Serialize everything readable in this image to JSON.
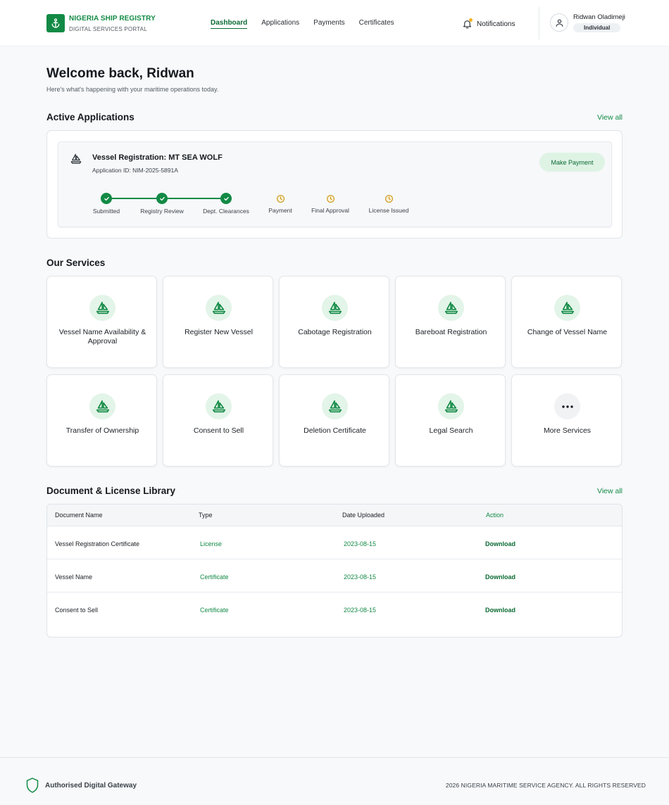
{
  "brand": {
    "title": "NIGERIA SHIP REGISTRY",
    "subtitle": "DIGITAL SERVICES PORTAL",
    "color": "#128a45"
  },
  "nav": [
    {
      "label": "Dashboard",
      "active": true
    },
    {
      "label": "Applications",
      "active": false
    },
    {
      "label": "Payments",
      "active": false
    },
    {
      "label": "Certificates",
      "active": false
    }
  ],
  "header": {
    "notifications_label": "Notifications",
    "user_name": "Ridwan Oladimeji",
    "user_role": "Individual"
  },
  "welcome": {
    "title": "Welcome back, Ridwan",
    "subtitle": "Here's what's happening with your maritime operations today."
  },
  "active_applications": {
    "title": "Active Applications",
    "view_all": "View all",
    "application": {
      "title": "Vessel Registration: MT SEA WOLF",
      "id": "Application ID: NIM-2025-5891A",
      "action": "Make Payment",
      "steps": [
        {
          "label": "Submitted",
          "status": "done"
        },
        {
          "label": "Registry Review",
          "status": "done"
        },
        {
          "label": "Dept. Clearances",
          "status": "done"
        },
        {
          "label": "Payment",
          "status": "pending"
        },
        {
          "label": "Final Approval",
          "status": "pending"
        },
        {
          "label": "License Issued",
          "status": "pending"
        }
      ]
    }
  },
  "services": {
    "title": "Our Services",
    "items": [
      {
        "label": "Vessel Name Availability & Approval",
        "icon": "sailboat-icon"
      },
      {
        "label": "Register New Vessel",
        "icon": "sailboat-icon"
      },
      {
        "label": "Cabotage Registration",
        "icon": "sailboat-icon"
      },
      {
        "label": "Bareboat Registration",
        "icon": "sailboat-icon"
      },
      {
        "label": "Change of Vessel Name",
        "icon": "sailboat-icon"
      },
      {
        "label": "Transfer of Ownership",
        "icon": "sailboat-icon"
      },
      {
        "label": "Consent to Sell",
        "icon": "sailboat-icon"
      },
      {
        "label": "Deletion Certificate",
        "icon": "sailboat-icon"
      },
      {
        "label": "Legal Search",
        "icon": "sailboat-icon"
      },
      {
        "label": "More Services",
        "icon": "more-horizontal-icon"
      }
    ]
  },
  "library": {
    "title": "Document & License Library",
    "view_all": "View all",
    "columns": [
      "Document Name",
      "Type",
      "Date Uploaded",
      "Action"
    ],
    "rows": [
      {
        "name": "Vessel Registration Certificate",
        "type": "License",
        "date": "2023-08-15",
        "action": "Download"
      },
      {
        "name": "Vessel Name",
        "type": "Certificate",
        "date": "2023-08-15",
        "action": "Download"
      },
      {
        "name": "Consent to Sell",
        "type": "Certificate",
        "date": "2023-08-15",
        "action": "Download"
      }
    ]
  },
  "footer": {
    "left": "Authorised Digital Gateway",
    "right": "2026 NIGERIA MARITIME SERVICE AGENCY. ALL RIGHTS RESERVED"
  }
}
